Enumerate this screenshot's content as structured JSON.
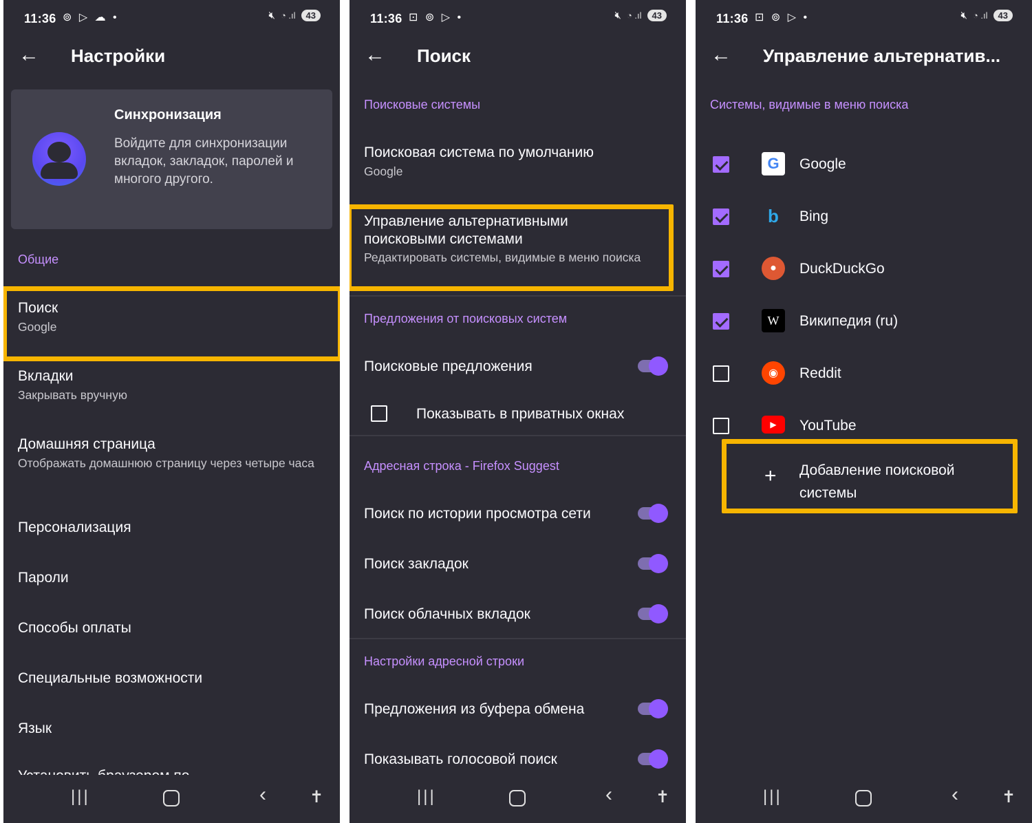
{
  "status_bar": {
    "time": "11:36",
    "battery": "43"
  },
  "screen1": {
    "title": "Настройки",
    "sync": {
      "title": "Синхронизация",
      "description": "Войдите для синхронизации вкладок, закладок, паролей и многого другого."
    },
    "section_general": "Общие",
    "items": [
      {
        "title": "Поиск",
        "subtitle": "Google"
      },
      {
        "title": "Вкладки",
        "subtitle": "Закрывать вручную"
      },
      {
        "title": "Домашняя страница",
        "subtitle": "Отображать домашнюю страницу через четыре часа"
      },
      {
        "title": "Персонализация"
      },
      {
        "title": "Пароли"
      },
      {
        "title": "Способы оплаты"
      },
      {
        "title": "Специальные возможности"
      },
      {
        "title": "Язык"
      }
    ],
    "cut_item": "Установить браузером по"
  },
  "screen2": {
    "title": "Поиск",
    "section_engines": "Поисковые системы",
    "default_engine": {
      "title": "Поисковая система по умолчанию",
      "subtitle": "Google"
    },
    "manage_alt": {
      "title": "Управление альтернативными поисковыми системами",
      "subtitle": "Редактировать системы, видимые в меню поиска"
    },
    "section_suggestions": "Предложения от поисковых систем",
    "search_suggestions": "Поисковые предложения",
    "show_private": "Показывать в приватных окнах",
    "section_address": "Адресная строка - Firefox Suggest",
    "history_search": "Поиск по истории просмотра сети",
    "bookmarks_search": "Поиск закладок",
    "cloud_tabs_search": "Поиск облачных вкладок",
    "section_address_settings": "Настройки адресной строки",
    "clipboard_suggestions": "Предложения из буфера обмена",
    "voice_search": "Показывать голосовой поиск",
    "toggle_colors": {
      "track": "#7e6eb0",
      "thumb": "#9059ff"
    }
  },
  "screen3": {
    "title": "Управление альтернатив...",
    "section": "Системы, видимые в меню поиска",
    "engines": [
      {
        "name": "Google",
        "checked": true,
        "icon": "google-icon"
      },
      {
        "name": "Bing",
        "checked": true,
        "icon": "bing-icon"
      },
      {
        "name": "DuckDuckGo",
        "checked": true,
        "icon": "duckduckgo-icon"
      },
      {
        "name": "Википедия (ru)",
        "checked": true,
        "icon": "wikipedia-icon"
      },
      {
        "name": "Reddit",
        "checked": false,
        "icon": "reddit-icon"
      },
      {
        "name": "YouTube",
        "checked": false,
        "icon": "youtube-icon"
      }
    ],
    "add_engine": "Добавление поисковой системы"
  },
  "highlight_color": "#f7b500",
  "accent_color": "#c690ff"
}
